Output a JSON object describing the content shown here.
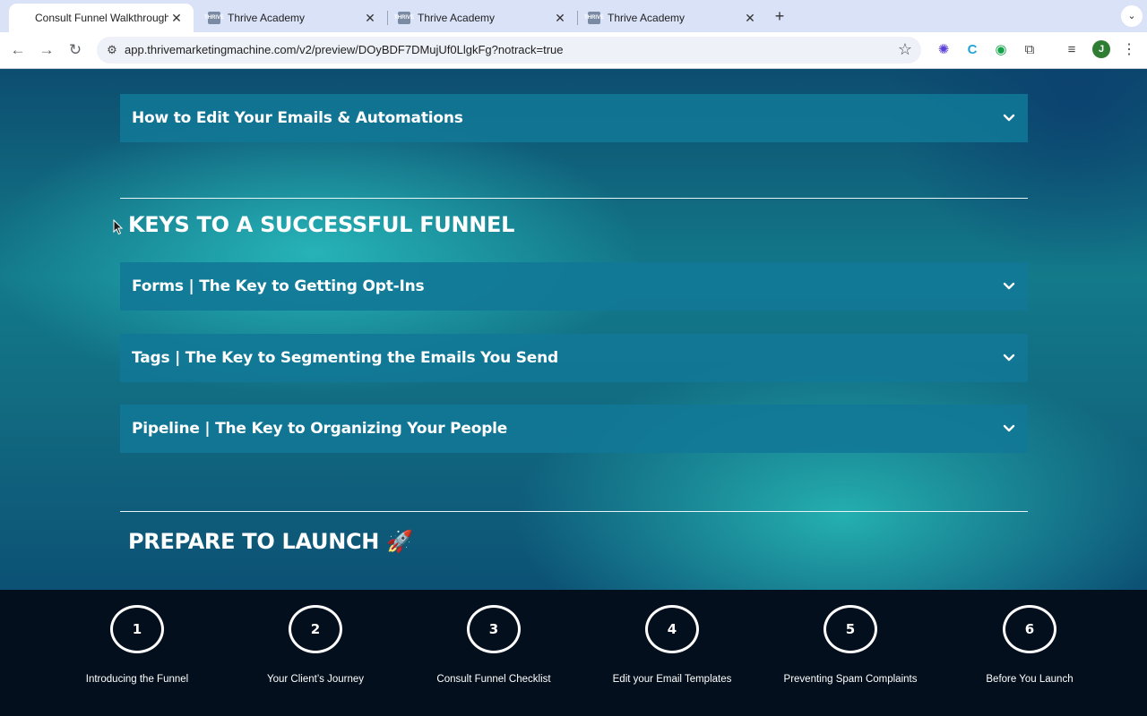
{
  "browser": {
    "tabs": [
      {
        "title": "Consult Funnel Walkthrough (",
        "active": true
      },
      {
        "title": "Thrive Academy",
        "active": false
      },
      {
        "title": "Thrive Academy",
        "active": false
      },
      {
        "title": "Thrive Academy",
        "active": false
      }
    ],
    "close_glyph": "✕",
    "new_tab_glyph": "+",
    "tab_menu_glyph": "⌄",
    "favicon_text": "THRIVE",
    "url": "app.thrivemarketingmachine.com/v2/preview/DOyBDF7DMujUf0LlgkFg?notrack=true",
    "profile_initial": "J",
    "icons": [
      "back-arrow-icon",
      "forward-arrow-icon",
      "reload-icon",
      "site-settings-icon",
      "bookmark-star-icon",
      "extension-icon",
      "puzzle-icon",
      "media-controls-icon",
      "kebab-menu-icon"
    ]
  },
  "content": {
    "top_accordion": {
      "label": "How to Edit Your Emails & Automations"
    },
    "section_keys": {
      "title": "KEYS TO A SUCCESSFUL FUNNEL",
      "items": [
        {
          "label": "Forms | The Key to Getting Opt-Ins"
        },
        {
          "label": "Tags | The Key to Segmenting the Emails You Send"
        },
        {
          "label": "Pipeline | The Key to Organizing Your People"
        }
      ]
    },
    "section_launch": {
      "title": "PREPARE TO LAUNCH 🚀"
    }
  },
  "steps": [
    {
      "number": "1",
      "caption": "Introducing the Funnel"
    },
    {
      "number": "2",
      "caption": "Your Client’s Journey"
    },
    {
      "number": "3",
      "caption": "Consult Funnel Checklist"
    },
    {
      "number": "4",
      "caption": "Edit your Email Templates"
    },
    {
      "number": "5",
      "caption": "Preventing Spam Complaints"
    },
    {
      "number": "6",
      "caption": "Before You Launch"
    }
  ],
  "colors": {
    "accordion_bg": "#1178a0",
    "steps_bg": "#030f1d",
    "tabstrip_bg": "#dae2f8"
  }
}
